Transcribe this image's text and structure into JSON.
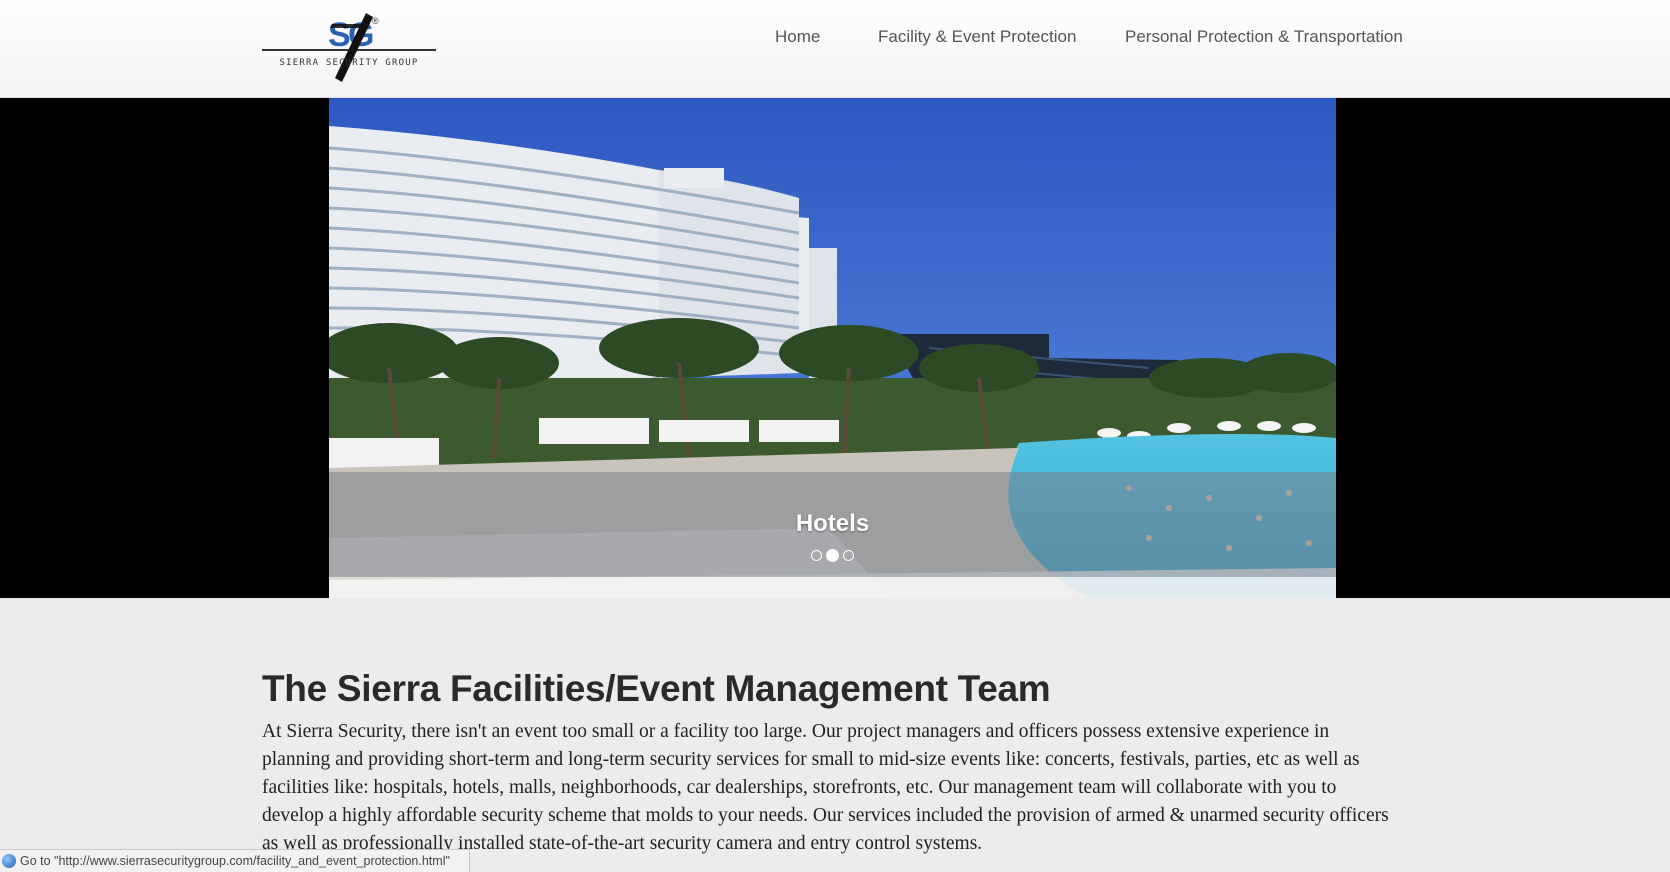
{
  "header": {
    "logo": {
      "monogram": "SG",
      "trademark": "®",
      "company": "SIERRA SECURITY GROUP"
    },
    "nav": [
      {
        "label": "Home"
      },
      {
        "label": "Facility & Event Protection"
      },
      {
        "label": "Personal Protection & Transportation"
      }
    ]
  },
  "hero": {
    "caption": "Hotels",
    "slides_total": 3,
    "active_slide": 2
  },
  "main": {
    "title": "The Sierra Facilities/Event Management Team",
    "body": "At Sierra Security, there isn't an event too small or a facility too large. Our project managers and officers possess extensive experience in planning and providing short-term and long-term security services for small to mid-size events like: concerts, festivals, parties, etc as well as facilities like: hospitals, hotels, malls, neighborhoods, car dealerships, storefronts, etc. Our management team will collaborate with you to develop a highly affordable security scheme that molds to your needs. Our services included the provision of armed & unarmed security officers as well as professionally installed state-of-the-art security camera and entry control systems."
  },
  "status_bar": {
    "icon": "globe-icon",
    "text": "Go to \"http://www.sierrasecuritygroup.com/facility_and_event_protection.html\""
  },
  "colors": {
    "header_bg": "#f7f7f7",
    "hero_bg": "#000000",
    "page_bg": "#edebeb",
    "logo_blue": "#2a62b0",
    "nav_text": "#555555"
  }
}
